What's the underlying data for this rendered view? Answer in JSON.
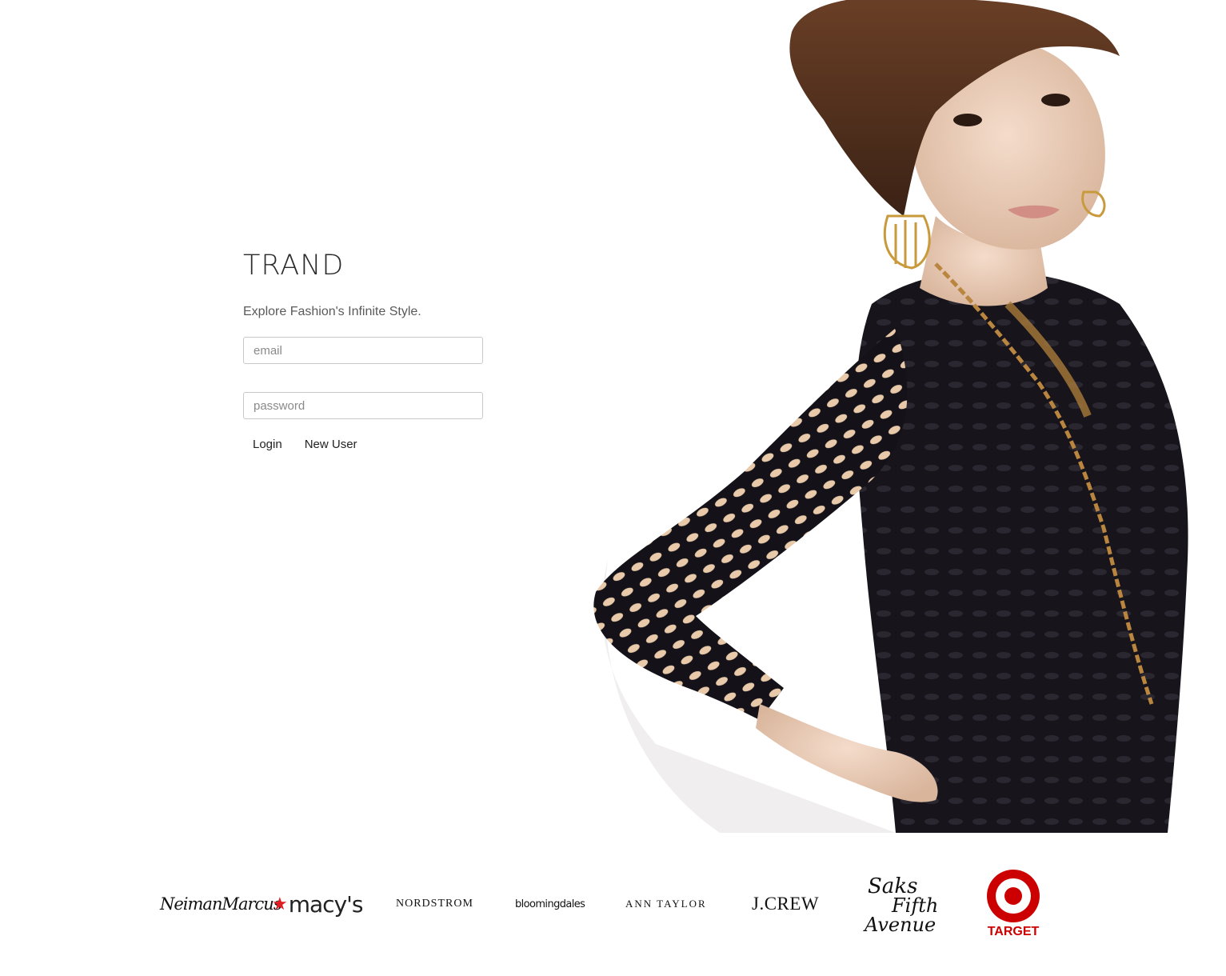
{
  "app": {
    "brand_name": "TRAND",
    "tagline": "Explore Fashion's Infinite Style."
  },
  "login_form": {
    "email": {
      "placeholder": "email",
      "value": ""
    },
    "password": {
      "placeholder": "password",
      "value": ""
    },
    "login_label": "Login",
    "new_user_label": "New User"
  },
  "hero_image": {
    "subject": "model-photo"
  },
  "brands": {
    "neiman_marcus": "NeimanMarcus",
    "macys": "macy's",
    "nordstrom": "NORDSTROM",
    "bloomingdales": "bloomingdales",
    "ann_taylor": "ANN TAYLOR",
    "jcrew": "J.CREW",
    "saks_line1": "Saks",
    "saks_line2": "Fifth",
    "saks_line3": "Avenue",
    "target": "TARGET"
  },
  "colors": {
    "macys_star": "#e21c23",
    "target_red": "#cc0000",
    "text": "#333333"
  }
}
